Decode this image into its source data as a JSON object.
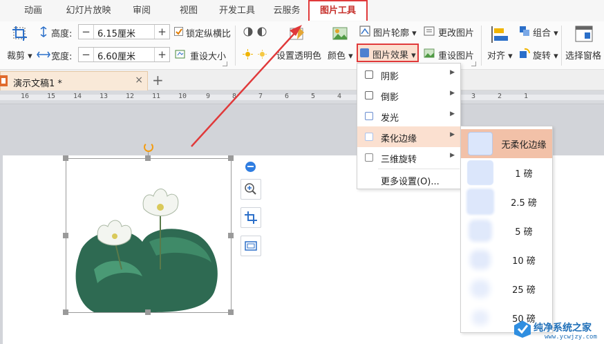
{
  "menu_tabs": [
    "动画",
    "幻灯片放映",
    "审阅",
    "视图",
    "开发工具",
    "云服务",
    "图片工具"
  ],
  "active_tab": "图片工具",
  "ribbon": {
    "crop_label": "裁剪",
    "height_label": "高度:",
    "height_value": "6.15厘米",
    "width_label": "宽度:",
    "width_value": "6.60厘米",
    "lock_ratio_label": "锁定纵横比",
    "reset_size_label": "重设大小",
    "transparency_label": "设置透明色",
    "color_label": "颜色",
    "outline_label": "图片轮廓",
    "effect_label": "图片效果",
    "change_pic_label": "更改图片",
    "reset_pic_label": "重设图片",
    "combine_label": "组合",
    "align_label": "对齐",
    "rotate_label": "旋转",
    "select_pane_label": "选择窗格"
  },
  "document": {
    "tab_title": "演示文稿1 *"
  },
  "ruler": [
    "16",
    "15",
    "14",
    "13",
    "12",
    "11",
    "10",
    "9",
    "8",
    "7",
    "6",
    "5",
    "4",
    "3",
    "2",
    "1"
  ],
  "effects_menu": [
    {
      "label": "阴影",
      "has_sub": true
    },
    {
      "label": "倒影",
      "has_sub": true
    },
    {
      "label": "发光",
      "has_sub": true
    },
    {
      "label": "柔化边缘",
      "has_sub": true
    },
    {
      "label": "三维旋转",
      "has_sub": true
    },
    {
      "label": "更多设置(O)...",
      "has_sub": false
    }
  ],
  "soft_edge_options": [
    "无柔化边缘",
    "1 磅",
    "2.5 磅",
    "5 磅",
    "10 磅",
    "25 磅",
    "50 磅"
  ],
  "watermark": {
    "title": "纯净系统之家",
    "url": "www.ycwjzy.com"
  },
  "colors": {
    "accent_red": "#e0393a",
    "highlight": "#fbe0d0",
    "selected_sub": "#f2c1a8",
    "swatch_blue": "#d9e5fb"
  }
}
